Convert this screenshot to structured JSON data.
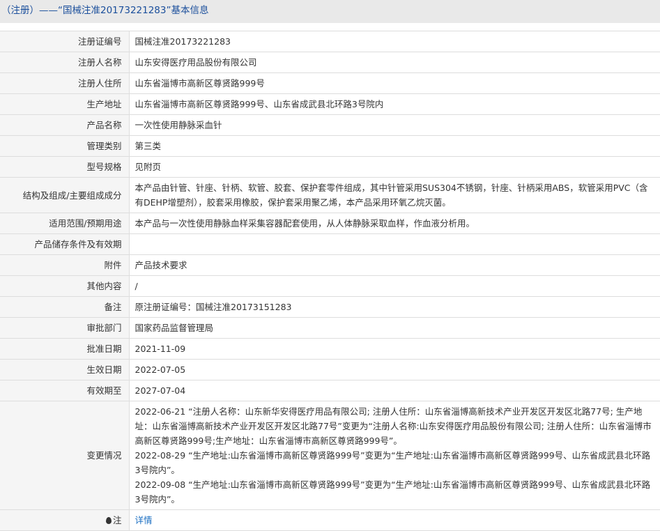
{
  "header": {
    "title": "（注册）——“国械注准20173221283”基本信息"
  },
  "rows": [
    {
      "label": "注册证编号",
      "value": "国械注准20173221283"
    },
    {
      "label": "注册人名称",
      "value": "山东安得医疗用品股份有限公司"
    },
    {
      "label": "注册人住所",
      "value": "山东省淄博市高新区尊贤路999号"
    },
    {
      "label": "生产地址",
      "value": "山东省淄博市高新区尊贤路999号、山东省成武县北环路3号院内"
    },
    {
      "label": "产品名称",
      "value": "一次性使用静脉采血针"
    },
    {
      "label": "管理类别",
      "value": "第三类"
    },
    {
      "label": "型号规格",
      "value": "见附页"
    },
    {
      "label": "结构及组成/主要组成成分",
      "value": "本产品由针管、针座、针柄、软管、胶套、保护套零件组成，其中针管采用SUS304不锈钢，针座、针柄采用ABS，软管采用PVC（含有DEHP增塑剂），胶套采用橡胶，保护套采用聚乙烯，本产品采用环氧乙烷灭菌。"
    },
    {
      "label": "适用范围/预期用途",
      "value": "本产品与一次性使用静脉血样采集容器配套使用，从人体静脉采取血样，作血液分析用。"
    },
    {
      "label": "产品储存条件及有效期",
      "value": ""
    },
    {
      "label": "附件",
      "value": "产品技术要求"
    },
    {
      "label": "其他内容",
      "value": "/"
    },
    {
      "label": "备注",
      "value": "原注册证编号：国械注准20173151283"
    },
    {
      "label": "审批部门",
      "value": "国家药品监督管理局"
    },
    {
      "label": "批准日期",
      "value": "2021-11-09"
    },
    {
      "label": "生效日期",
      "value": "2022-07-05"
    },
    {
      "label": "有效期至",
      "value": "2027-07-04"
    }
  ],
  "changes": {
    "label": "变更情况",
    "items": [
      "2022-06-21 “注册人名称：山东新华安得医疗用品有限公司; 注册人住所：山东省淄博高新技术产业开发区开发区北路77号; 生产地址：山东省淄博高新技术产业开发区开发区北路77号”变更为“注册人名称:山东安得医疗用品股份有限公司; 注册人住所：山东省淄博市高新区尊贤路999号;生产地址：山东省淄博市高新区尊贤路999号”。",
      "2022-08-29 “生产地址:山东省淄博市高新区尊贤路999号”变更为“生产地址:山东省淄博市高新区尊贤路999号、山东省成武县北环路3号院内”。",
      "2022-09-08 “生产地址:山东省淄博市高新区尊贤路999号”变更为“生产地址:山东省淄博市高新区尊贤路999号、山东省成武县北环路3号院内”。"
    ]
  },
  "note": {
    "label": "注",
    "link": "详情"
  }
}
